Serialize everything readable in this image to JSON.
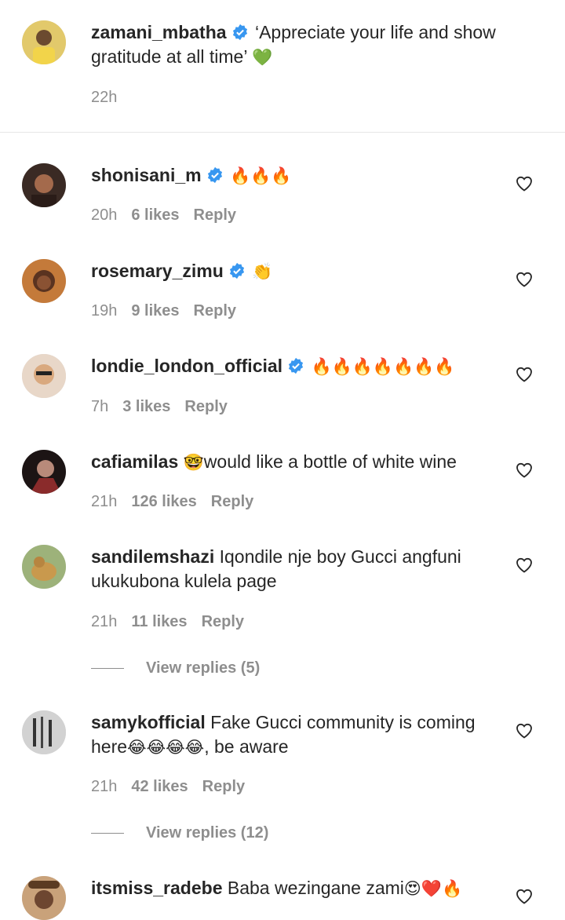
{
  "caption": {
    "username": "zamani_mbatha",
    "text": "‘Appreciate your life and show gratitude at all time’",
    "emoji": "💚",
    "time": "22h"
  },
  "comments": [
    {
      "username": "shonisani_m",
      "verified": true,
      "text": "",
      "emoji": "🔥🔥🔥",
      "time": "20h",
      "likes": "6 likes",
      "reply": "Reply"
    },
    {
      "username": "rosemary_zimu",
      "verified": true,
      "text": "",
      "emoji": "👏",
      "time": "19h",
      "likes": "9 likes",
      "reply": "Reply"
    },
    {
      "username": "londie_london_official",
      "verified": true,
      "text": "",
      "emoji": "🔥🔥🔥🔥🔥🔥🔥",
      "time": "7h",
      "likes": "3 likes",
      "reply": "Reply"
    },
    {
      "username": "cafiamilas",
      "verified": false,
      "emoji_before": "🤓",
      "text": "would like a bottle of white wine",
      "time": "21h",
      "likes": "126 likes",
      "reply": "Reply"
    },
    {
      "username": "sandilemshazi",
      "verified": false,
      "text": "Iqondile nje boy Gucci angfuni ukukubona kulela page",
      "time": "21h",
      "likes": "11 likes",
      "reply": "Reply",
      "view_replies": "View replies (5)"
    },
    {
      "username": "samykofficial",
      "verified": false,
      "text": "Fake Gucci community is coming here",
      "emoji": "😂😂😂😂",
      "text_after": ", be aware",
      "time": "21h",
      "likes": "42 likes",
      "reply": "Reply",
      "view_replies": "View replies (12)"
    },
    {
      "username": "itsmiss_radebe",
      "verified": false,
      "text": "Baba wezingane zami",
      "emoji": "😍❤️🔥"
    }
  ],
  "icons": {
    "verified": "verified-badge-icon",
    "heart": "heart-outline-icon",
    "verified_color": "#3897f0"
  }
}
